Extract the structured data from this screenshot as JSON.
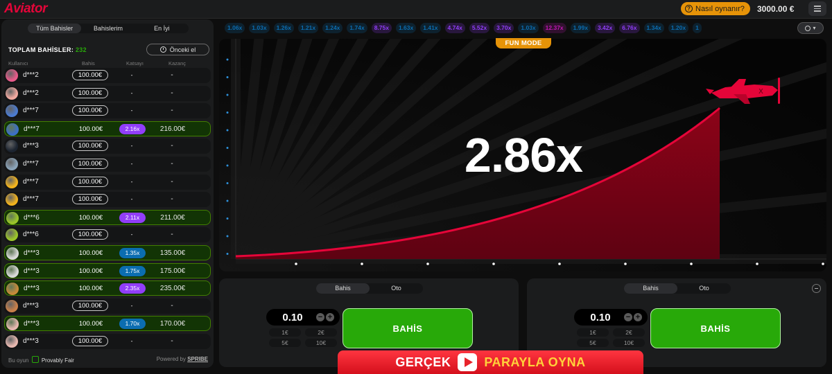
{
  "header": {
    "logo_text": "Aviator",
    "how_to_label": "Nasıl oynanır?",
    "balance": "3000.00 €"
  },
  "bets_panel": {
    "tabs": [
      {
        "label": "Tüm Bahisler",
        "active": true
      },
      {
        "label": "Bahislerim",
        "active": false
      },
      {
        "label": "En İyi",
        "active": false
      }
    ],
    "total_label": "TOPLAM BAHİSLER:",
    "total_count": "232",
    "previous_button": "Önceki el",
    "columns": {
      "user": "Kullanıcı",
      "bet": "Bahis",
      "coef": "Katsayı",
      "win": "Kazanç"
    },
    "rows": [
      {
        "user": "d***2",
        "bet": "100.00€",
        "coef": "-",
        "win": "-",
        "won": false,
        "avatar_color": "#e85a8a"
      },
      {
        "user": "d***2",
        "bet": "100.00€",
        "coef": "-",
        "win": "-",
        "won": false,
        "avatar_color": "#f0a9a0"
      },
      {
        "user": "d***7",
        "bet": "100.00€",
        "coef": "-",
        "win": "-",
        "won": false,
        "avatar_color": "#4b7bd0"
      },
      {
        "user": "d***7",
        "bet": "100.00€",
        "coef": "2.16x",
        "win": "216.00€",
        "won": true,
        "coef_color": "#913ef8",
        "avatar_color": "#3c6fc6"
      },
      {
        "user": "d***3",
        "bet": "100.00€",
        "coef": "-",
        "win": "-",
        "won": false,
        "avatar_color": "#1c2430"
      },
      {
        "user": "d***7",
        "bet": "100.00€",
        "coef": "-",
        "win": "-",
        "won": false,
        "avatar_color": "#8aa3b8"
      },
      {
        "user": "d***7",
        "bet": "100.00€",
        "coef": "-",
        "win": "-",
        "won": false,
        "avatar_color": "#f2b31d"
      },
      {
        "user": "d***7",
        "bet": "100.00€",
        "coef": "-",
        "win": "-",
        "won": false,
        "avatar_color": "#f2b31d"
      },
      {
        "user": "d***6",
        "bet": "100.00€",
        "coef": "2.11x",
        "win": "211.00€",
        "won": true,
        "coef_color": "#913ef8",
        "avatar_color": "#9bc52a"
      },
      {
        "user": "d***6",
        "bet": "100.00€",
        "coef": "-",
        "win": "-",
        "won": false,
        "avatar_color": "#9bc52a"
      },
      {
        "user": "d***3",
        "bet": "100.00€",
        "coef": "1.35x",
        "win": "135.00€",
        "won": true,
        "coef_color": "#0b6db1",
        "avatar_color": "#d9d9d9"
      },
      {
        "user": "d***3",
        "bet": "100.00€",
        "coef": "1.75x",
        "win": "175.00€",
        "won": true,
        "coef_color": "#0b6db1",
        "avatar_color": "#d9d9d9"
      },
      {
        "user": "d***3",
        "bet": "100.00€",
        "coef": "2.35x",
        "win": "235.00€",
        "won": true,
        "coef_color": "#913ef8",
        "avatar_color": "#c78a3a"
      },
      {
        "user": "d***3",
        "bet": "100.00€",
        "coef": "-",
        "win": "-",
        "won": false,
        "avatar_color": "#c9804a"
      },
      {
        "user": "d***3",
        "bet": "100.00€",
        "coef": "1.70x",
        "win": "170.00€",
        "won": true,
        "coef_color": "#0b6db1",
        "avatar_color": "#e7b8b0"
      },
      {
        "user": "d***3",
        "bet": "100.00€",
        "coef": "-",
        "win": "-",
        "won": false,
        "avatar_color": "#e7b8b0"
      }
    ],
    "footer_left_prefix": "Bu oyun",
    "footer_left_label": "Provably Fair",
    "footer_right_prefix": "Powered by",
    "footer_right_brand": "SPRIBE"
  },
  "history": [
    {
      "value": "1.06x",
      "color": "#0b6db1"
    },
    {
      "value": "1.03x",
      "color": "#0b6db1"
    },
    {
      "value": "1.26x",
      "color": "#0b6db1"
    },
    {
      "value": "1.21x",
      "color": "#0b6db1"
    },
    {
      "value": "1.24x",
      "color": "#0b6db1"
    },
    {
      "value": "1.74x",
      "color": "#0b6db1"
    },
    {
      "value": "8.75x",
      "color": "#913ef8"
    },
    {
      "value": "1.63x",
      "color": "#0b6db1"
    },
    {
      "value": "1.41x",
      "color": "#0b6db1"
    },
    {
      "value": "4.74x",
      "color": "#913ef8"
    },
    {
      "value": "5.52x",
      "color": "#913ef8"
    },
    {
      "value": "3.70x",
      "color": "#913ef8"
    },
    {
      "value": "1.03x",
      "color": "#0b6db1"
    },
    {
      "value": "12.37x",
      "color": "#c017b4"
    },
    {
      "value": "1.99x",
      "color": "#0b6db1"
    },
    {
      "value": "3.42x",
      "color": "#913ef8"
    },
    {
      "value": "6.76x",
      "color": "#913ef8"
    },
    {
      "value": "1.34x",
      "color": "#0b6db1"
    },
    {
      "value": "1.20x",
      "color": "#0b6db1"
    },
    {
      "value": "1",
      "color": "#0b6db1"
    }
  ],
  "game": {
    "fun_mode_label": "FUN MODE",
    "multiplier": "2.86x",
    "curve_color": "#e50539",
    "plane_icon": "plane-icon"
  },
  "bet_controls": [
    {
      "tabs": [
        "Bahis",
        "Oto"
      ],
      "amount": "0.10",
      "quick_amounts": [
        "1€",
        "2€",
        "5€",
        "10€"
      ],
      "button_label": "BAHİS"
    },
    {
      "tabs": [
        "Bahis",
        "Oto"
      ],
      "amount": "0.10",
      "quick_amounts": [
        "1€",
        "2€",
        "5€",
        "10€"
      ],
      "button_label": "BAHİS"
    }
  ],
  "promo": {
    "left": "GERÇEK",
    "right": "PARAYLA OYNA"
  }
}
